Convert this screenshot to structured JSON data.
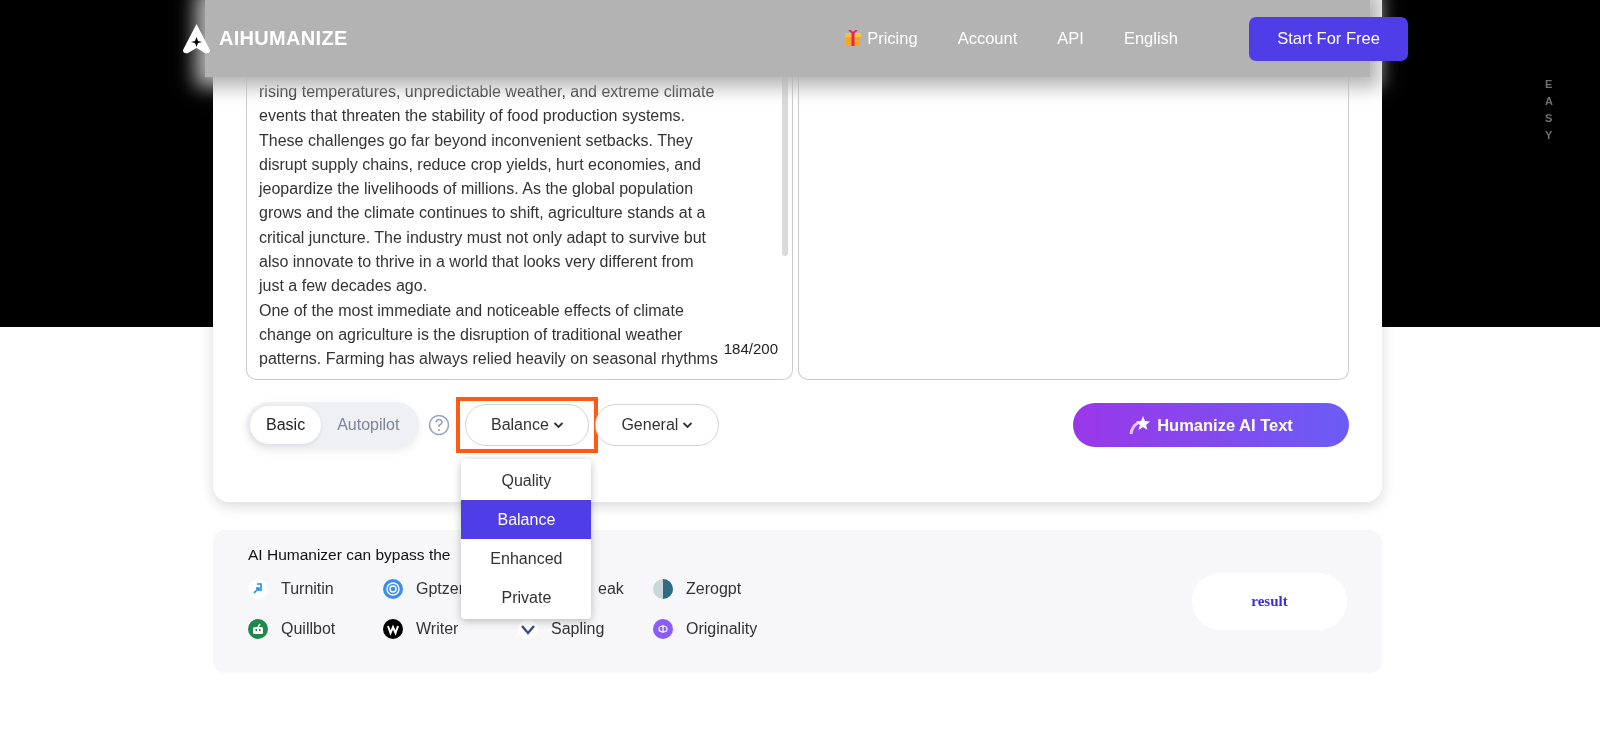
{
  "header": {
    "logo": "AIHUMANIZE",
    "nav": [
      {
        "label": "Pricing",
        "kind": "gift"
      },
      {
        "label": "Account",
        "kind": "plain"
      },
      {
        "label": "API",
        "kind": "plain"
      },
      {
        "label": "English",
        "kind": "plain"
      }
    ],
    "cta": "Start For Free"
  },
  "side_label": "EASY",
  "input": {
    "paragraphs": [
      [
        "rising temperatures, unpredictable weather, and extreme climate",
        "events that threaten the stability of food production systems.",
        "These challenges go far beyond inconvenient setbacks. They",
        "disrupt supply chains, reduce crop yields, hurt economies, and",
        "jeopardize the livelihoods of millions. As the global population",
        "grows and the climate continues to shift, agriculture stands at a",
        "critical juncture. The industry must not only adapt to survive but",
        "also innovate to thrive in a world that looks very different from",
        "just a few decades ago."
      ],
      [
        "One of the most immediate and noticeable effects of climate",
        "change on agriculture is the disruption of traditional weather",
        "patterns. Farming has always relied heavily on seasonal rhythms"
      ]
    ],
    "counter": "184/200"
  },
  "modes": [
    {
      "label": "Basic",
      "selected": true
    },
    {
      "label": "Autopilot",
      "selected": false
    }
  ],
  "dropdowns": [
    {
      "label": "Balance",
      "highlighted": true
    },
    {
      "label": "General",
      "highlighted": false
    }
  ],
  "menu": [
    {
      "label": "Quality",
      "selected": false
    },
    {
      "label": "Balance",
      "selected": true
    },
    {
      "label": "Enhanced",
      "selected": false
    },
    {
      "label": "Private",
      "selected": false
    }
  ],
  "action": "Humanize AI Text",
  "bypass": {
    "title": "AI Humanizer can bypass the",
    "detectors": [
      {
        "name": "Turnitin",
        "kind": "turnitin"
      },
      {
        "name": "Gptzer",
        "kind": "gptzero"
      },
      {
        "name": "eak",
        "kind": "hidden"
      },
      {
        "name": "Zerogpt",
        "kind": "zerogpt"
      },
      {
        "name": "Quillbot",
        "kind": "quillbot"
      },
      {
        "name": "Writer",
        "kind": "writer"
      },
      {
        "name": "Sapling",
        "kind": "sapling"
      },
      {
        "name": "Originality",
        "kind": "originality"
      }
    ],
    "result": "result"
  }
}
